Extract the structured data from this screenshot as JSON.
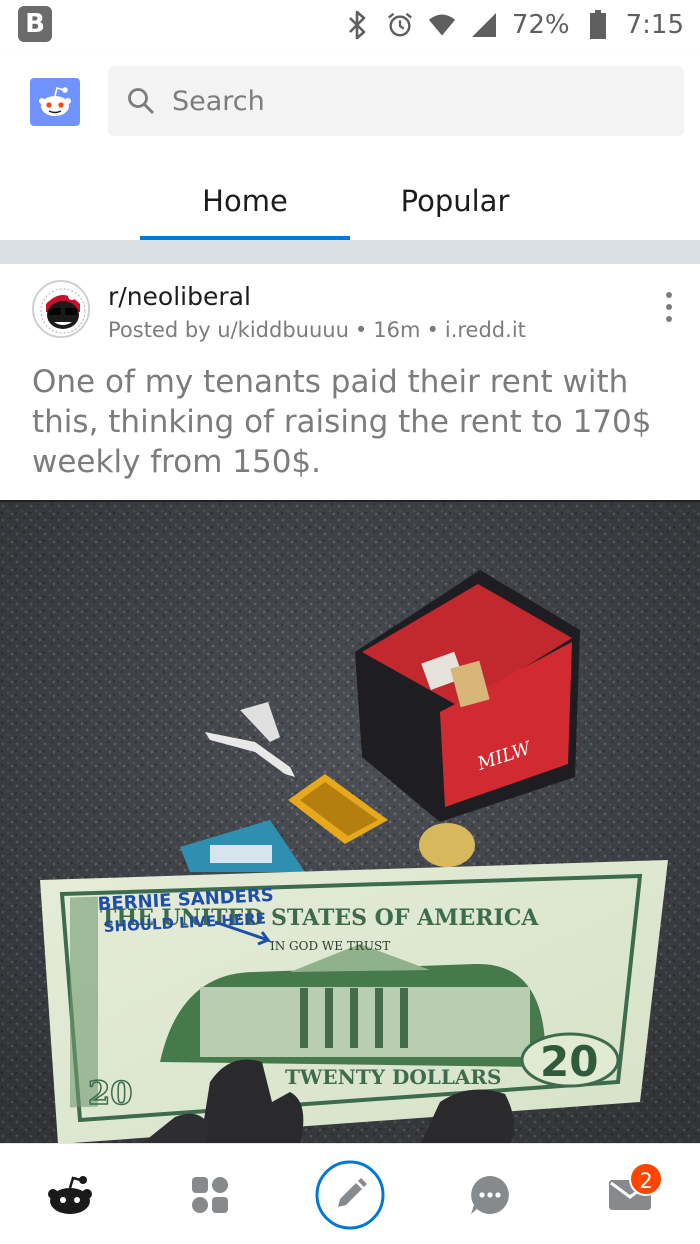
{
  "status_bar": {
    "app_badge": "B",
    "battery": "72%",
    "time": "7:15"
  },
  "header": {
    "search_placeholder": "Search",
    "tabs": [
      {
        "label": "Home",
        "active": true
      },
      {
        "label": "Popular",
        "active": false
      }
    ],
    "accent_color": "#0079d3"
  },
  "post": {
    "subreddit": "r/neoliberal",
    "posted_by": "Posted by u/kiddbuuuu",
    "age": "16m",
    "domain": "i.redd.it",
    "title": "One of my tenants paid their rent with this, thinking of raising the rent to 170$ weekly from 150$."
  },
  "image_scene": {
    "stamp_line1": "BERNIE SANDERS",
    "stamp_line2": "SHOULD LIVE HERE",
    "bill_header": "THE UNITED STATES OF AMERICA",
    "bill_motto": "IN GOD     WE TRUST",
    "bill_footer": "TWENTY DOLLARS",
    "bill_value": "20"
  },
  "bottom_nav": {
    "items": [
      "home",
      "discover",
      "create",
      "chat",
      "inbox"
    ],
    "inbox_badge": "2"
  }
}
